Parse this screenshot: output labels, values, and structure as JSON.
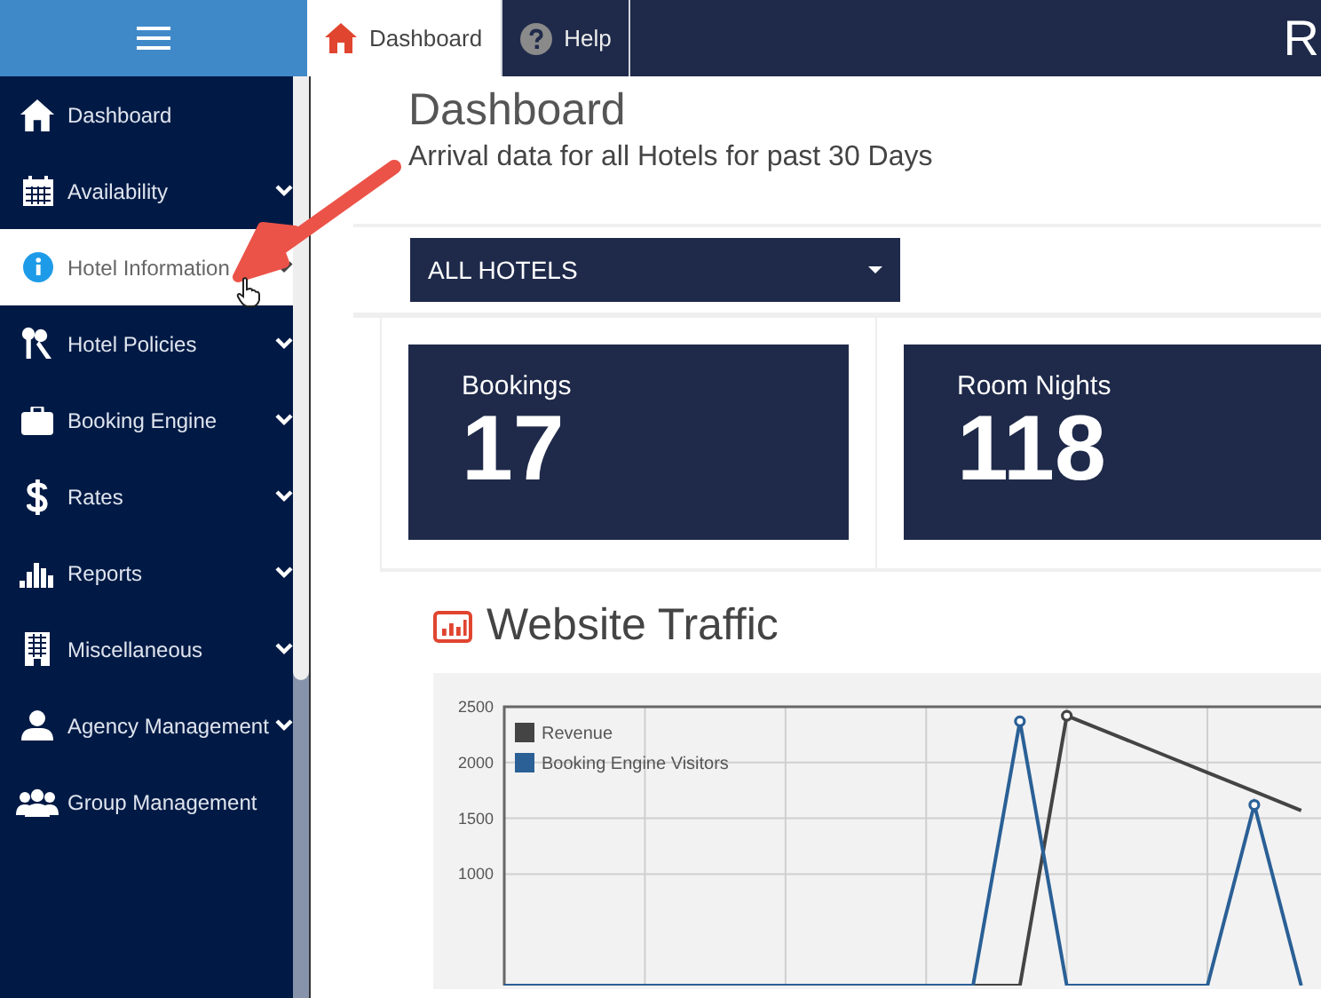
{
  "tabs": [
    {
      "label": "Dashboard",
      "selected": true
    },
    {
      "label": "Help",
      "selected": false
    }
  ],
  "brand": "R",
  "sidebar": {
    "items": [
      {
        "label": "Dashboard",
        "expandable": false,
        "selected": false
      },
      {
        "label": "Availability",
        "expandable": true,
        "selected": false
      },
      {
        "label": "Hotel Information",
        "expandable": true,
        "selected": true
      },
      {
        "label": "Hotel Policies",
        "expandable": true,
        "selected": false
      },
      {
        "label": "Booking Engine",
        "expandable": true,
        "selected": false
      },
      {
        "label": "Rates",
        "expandable": true,
        "selected": false
      },
      {
        "label": "Reports",
        "expandable": true,
        "selected": false
      },
      {
        "label": "Miscellaneous",
        "expandable": true,
        "selected": false
      },
      {
        "label": "Agency Management",
        "expandable": true,
        "selected": false
      },
      {
        "label": "Group Management",
        "expandable": false,
        "selected": false
      }
    ]
  },
  "page": {
    "title": "Dashboard",
    "subtitle": "Arrival data for all Hotels for past 30 Days"
  },
  "hotel_select": {
    "value": "ALL HOTELS"
  },
  "stats": [
    {
      "label": "Bookings",
      "value": "17"
    },
    {
      "label": "Room Nights",
      "value": "118"
    }
  ],
  "traffic": {
    "title": "Website Traffic",
    "chart_data": {
      "type": "line",
      "categories": [
        null,
        null,
        null,
        null,
        null,
        null,
        null,
        null,
        null,
        null,
        null,
        null,
        null,
        null,
        null,
        null,
        null,
        null
      ],
      "ylim": [
        0,
        2500
      ],
      "yticks": [
        1000,
        1500,
        2000,
        2500
      ],
      "grid": true,
      "legend": true,
      "series": [
        {
          "name": "Revenue",
          "color": "#444444",
          "values": [
            0,
            0,
            0,
            0,
            0,
            0,
            0,
            0,
            0,
            0,
            0,
            0,
            2420,
            2250,
            2080,
            1910,
            1740,
            1570
          ]
        },
        {
          "name": "Booking Engine Visitors",
          "color": "#2a6096",
          "values": [
            0,
            0,
            0,
            0,
            0,
            0,
            0,
            0,
            0,
            0,
            0,
            2370,
            0,
            0,
            0,
            0,
            1620,
            0
          ]
        }
      ]
    }
  }
}
